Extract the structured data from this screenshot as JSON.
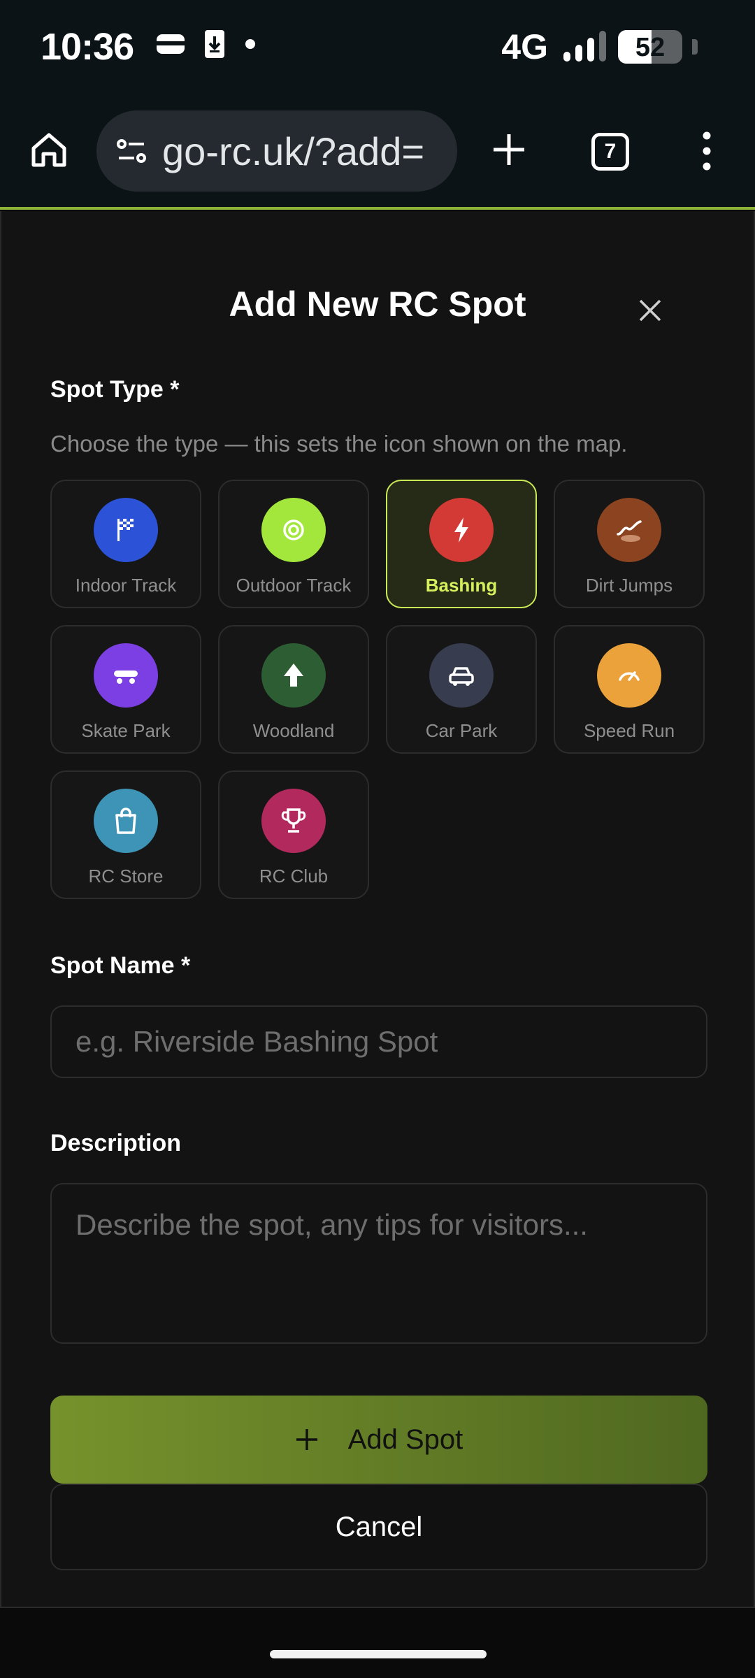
{
  "status_bar": {
    "time": "10:36",
    "network": "4G",
    "battery_percent": "52",
    "battery_level": 0.52,
    "icons": [
      "wallet-icon",
      "download-icon",
      "dot-icon",
      "signal-icon",
      "battery-icon"
    ]
  },
  "browser": {
    "url": "go-rc.uk/?add=",
    "tab_count": "7",
    "icons": [
      "home-icon",
      "tune-icon",
      "new-tab-icon",
      "tabs-icon",
      "more-icon"
    ]
  },
  "modal": {
    "title": "Add New RC Spot",
    "spot_type": {
      "label": "Spot Type *",
      "hint": "Choose the type — this sets the icon shown on the map.",
      "selected": "Bashing",
      "options": [
        {
          "label": "Indoor Track",
          "color": "#2c52d8",
          "icon": "checkered-flag-icon"
        },
        {
          "label": "Outdoor Track",
          "color": "#a3e73c",
          "icon": "target-icon"
        },
        {
          "label": "Bashing",
          "color": "#d43a35",
          "icon": "lightning-icon"
        },
        {
          "label": "Dirt Jumps",
          "color": "#8b4320",
          "icon": "jump-ramp-icon"
        },
        {
          "label": "Skate Park",
          "color": "#7b3fe4",
          "icon": "skateboard-icon"
        },
        {
          "label": "Woodland",
          "color": "#2d5d32",
          "icon": "tree-icon"
        },
        {
          "label": "Car Park",
          "color": "#373c4e",
          "icon": "car-icon"
        },
        {
          "label": "Speed Run",
          "color": "#eca23a",
          "icon": "speedometer-icon"
        },
        {
          "label": "RC Store",
          "color": "#3e94b6",
          "icon": "shopping-bag-icon"
        },
        {
          "label": "RC Club",
          "color": "#b22a5d",
          "icon": "trophy-icon"
        }
      ]
    },
    "spot_name": {
      "label": "Spot Name *",
      "placeholder": "e.g. Riverside Bashing Spot",
      "value": ""
    },
    "description": {
      "label": "Description",
      "placeholder": "Describe the spot, any tips for visitors...",
      "value": ""
    },
    "add_button": "Add Spot",
    "cancel_button": "Cancel"
  },
  "colors": {
    "accent": "#c9ea55",
    "add_button": "#6a8428",
    "background": "#131313"
  }
}
